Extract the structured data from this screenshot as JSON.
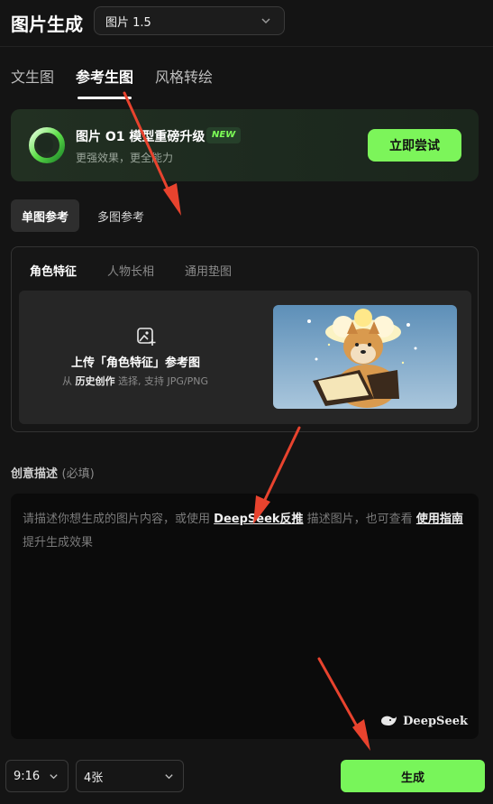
{
  "header": {
    "title": "图片生成",
    "model_value": "图片 1.5"
  },
  "tabs": [
    {
      "label": "文生图",
      "active": false
    },
    {
      "label": "参考生图",
      "active": true
    },
    {
      "label": "风格转绘",
      "active": false
    }
  ],
  "promo": {
    "title": "图片 O1 模型重磅升级",
    "badge": "NEW",
    "subtitle": "更强效果，更全能力",
    "button": "立即尝试"
  },
  "reference_mode": {
    "single": "单图参考",
    "multi": "多图参考",
    "active": "单图参考"
  },
  "upload": {
    "subtabs": [
      "角色特征",
      "人物长相",
      "通用垫图"
    ],
    "active_subtab": "角色特征",
    "title": "上传「角色特征」参考图",
    "from": "从",
    "history": "历史创作",
    "choose": "选择, 支持 JPG/PNG"
  },
  "description": {
    "label": "创意描述",
    "required": "(必填)",
    "placeholder_part1": "请描述你想生成的图片内容，或使用",
    "link_deepseek": "DeepSeek反推",
    "placeholder_part2": "描述图片，也可查看",
    "link_guide": "使用指南",
    "placeholder_part3": "提升生成效果",
    "brand": "DeepSeek"
  },
  "bottom": {
    "ratio": "9:16",
    "count": "4张",
    "generate": "生成"
  },
  "colors": {
    "accent_green": "#7cf55a",
    "annotation_red": "#e8432e",
    "background": "#141414"
  }
}
